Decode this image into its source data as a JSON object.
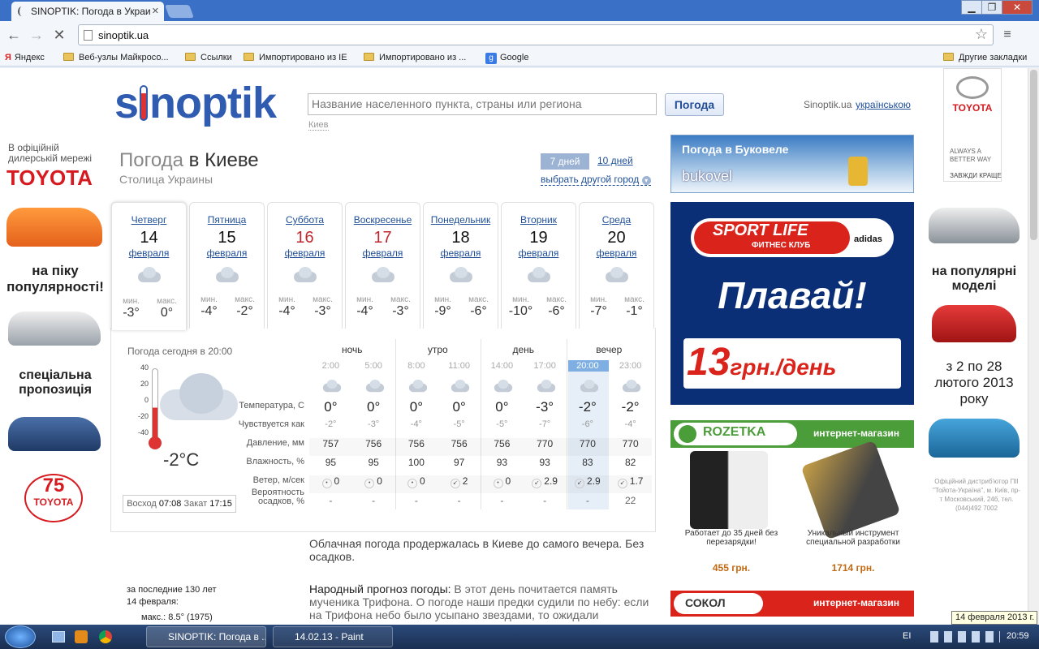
{
  "browser": {
    "tab_title": "SINOPTIK: Погода в Украи",
    "address": "sinoptik.ua",
    "bookmarks": [
      "Яндекс",
      "Веб-узлы Майкросо...",
      "Ссылки",
      "Импортировано из IE",
      "Импортировано из ...",
      "Google"
    ],
    "other_bookmarks": "Другие закладки",
    "tooltip": "14 февраля 2013 г."
  },
  "site": {
    "logo_pre": "s",
    "logo_post": "noptik",
    "search_placeholder": "Название населенного пункта, страны или региона",
    "search_button": "Погода",
    "search_hint": "Киев",
    "site_name": "Sinoptik.ua",
    "lang_link": "українською",
    "title_a": "Погода",
    "title_b": "в Киеве",
    "subtitle": "Столица Украины",
    "range_7": "7 дней",
    "range_10": "10 дней",
    "choose_city": "выбрать другой город"
  },
  "days": [
    {
      "name": "Четверг",
      "num": "14",
      "month": "февраля",
      "min": "-3°",
      "max": "0°",
      "weekend": false
    },
    {
      "name": "Пятница",
      "num": "15",
      "month": "февраля",
      "min": "-4°",
      "max": "-2°",
      "weekend": false
    },
    {
      "name": "Суббота",
      "num": "16",
      "month": "февраля",
      "min": "-4°",
      "max": "-3°",
      "weekend": true
    },
    {
      "name": "Воскресенье",
      "num": "17",
      "month": "февраля",
      "min": "-4°",
      "max": "-3°",
      "weekend": true
    },
    {
      "name": "Понедельник",
      "num": "18",
      "month": "февраля",
      "min": "-9°",
      "max": "-6°",
      "weekend": false
    },
    {
      "name": "Вторник",
      "num": "19",
      "month": "февраля",
      "min": "-10°",
      "max": "-6°",
      "weekend": false
    },
    {
      "name": "Среда",
      "num": "20",
      "month": "февраля",
      "min": "-7°",
      "max": "-1°",
      "weekend": false
    }
  ],
  "min_label": "мин.",
  "max_label": "макс.",
  "today": {
    "label": "Погода сегодня в 20:00",
    "temp": "-2°C",
    "scale": [
      "40",
      "20",
      "0",
      "-20",
      "-40"
    ],
    "sunrise_label": "Восход",
    "sunrise": "07:08",
    "sunset_label": "Закат",
    "sunset": "17:15",
    "history_title": "за последние 130 лет",
    "history_date": "14 февраля:",
    "history_max": "макс.: 8.5° (1975)"
  },
  "periods": [
    "ночь",
    "утро",
    "день",
    "вечер"
  ],
  "hours": [
    "2:00",
    "5:00",
    "8:00",
    "11:00",
    "14:00",
    "17:00",
    "20:00",
    "23:00"
  ],
  "row_labels": [
    "Температура, С",
    "Чувствуется как",
    "Давление, мм",
    "Влажность, %",
    "Ветер, м/сек",
    "Вероятность осадков, %"
  ],
  "temps": [
    "0°",
    "0°",
    "0°",
    "0°",
    "0°",
    "-3°",
    "-2°",
    "-2°"
  ],
  "feels": [
    "-2°",
    "-3°",
    "-4°",
    "-5°",
    "-5°",
    "-7°",
    "-6°",
    "-4°"
  ],
  "pressure": [
    "757",
    "756",
    "756",
    "756",
    "756",
    "770",
    "770",
    "770"
  ],
  "humidity": [
    "95",
    "95",
    "100",
    "97",
    "93",
    "93",
    "83",
    "82"
  ],
  "wind": [
    "0",
    "0",
    "0",
    "2",
    "0",
    "2.9",
    "2.9",
    "1.7"
  ],
  "precip": [
    "-",
    "-",
    "-",
    "-",
    "-",
    "-",
    "-",
    "22"
  ],
  "description": "Облачная погода продержалась в Киеве до самого вечера. Без осадков.",
  "folk_title": "Народный прогноз погоды:",
  "folk_text": "В этот день почитается память мученика Трифона. О погоде наши предки судили по небу: если на Трифона небо было усыпано звездами, то ожидали",
  "ads": {
    "left_top": "В офіційній дилерській мережі",
    "toyota": "TOYOTA",
    "left_mid": "на піку популярності!",
    "left_low": "спеціальна пропозиція",
    "left_75": "75",
    "bukovel_title": "Погода в Буковеле",
    "bukovel_logo": "bukovel",
    "sport_life": "SPORT LIFE",
    "sport_sub": "ФИТНЕС КЛУБ",
    "adidas": "adidas",
    "swim": "Плавай!",
    "price_big": "13",
    "price_rest": "грн./день",
    "rozetka": "ROZETKA",
    "rozetka_tag": "интернет-магазин",
    "item1_text": "Работает до 35 дней без перезарядки!",
    "item1_price": "455 грн.",
    "item2_text": "Уникальный инструмент специальной разработки",
    "item2_price": "1714 грн.",
    "sokol": "СОКОЛ",
    "right_slogan1": "ALWAYS A BETTER WAY",
    "right_slogan2": "ЗАВЖДИ КРАЩЕ",
    "right_mid": "на популярні моделі",
    "right_dates": "з 2 по 28 лютого 2013 року",
    "right_small": "Офіційний дистриб'ютор ПІІ \"Тойота-Україна\", м. Київ, пр-т Московський, 24б, тел. (044)492 7002"
  },
  "taskbar": {
    "item1": "SINOPTIK: Погода в ...",
    "item2": "14.02.13 - Paint",
    "lang": "EI",
    "clock": "20:59"
  }
}
